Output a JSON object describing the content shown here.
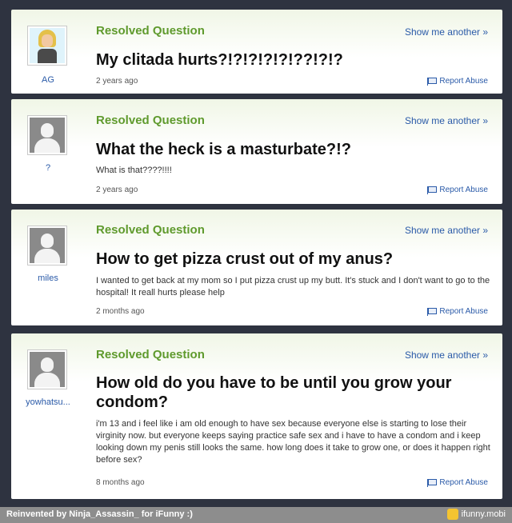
{
  "cards": [
    {
      "username": "AG",
      "resolved_label": "Resolved Question",
      "show_another": "Show me another »",
      "title": "My clitada hurts?!?!?!?!?!??!?!?",
      "body": "",
      "age": "2 years ago",
      "report": "Report Abuse"
    },
    {
      "username": "?",
      "resolved_label": "Resolved Question",
      "show_another": "Show me another »",
      "title": "What the heck is a masturbate?!?",
      "body": "What is that????!!!!",
      "age": "2 years ago",
      "report": "Report Abuse"
    },
    {
      "username": "miles",
      "resolved_label": "Resolved Question",
      "show_another": "Show me another »",
      "title": "How to get pizza crust out of my anus?",
      "body": "I wanted to get back at my mom so I put pizza crust up my butt. It's stuck and I don't want to go to the hospital! It reall hurts please help",
      "age": "2 months ago",
      "report": "Report Abuse"
    },
    {
      "username": "yowhatsu...",
      "resolved_label": "Resolved Question",
      "show_another": "Show me another »",
      "title": "How old do you have to be until you grow your condom?",
      "body": "i'm 13 and i feel like i am old enough to have sex because everyone else is starting to lose their virginity now. but everyone keeps saying practice safe sex and i have to have a condom and i keep looking down my penis still looks the same. how long does it take to grow one, or does it happen right before sex?",
      "age": "8 months ago",
      "report": "Report Abuse"
    }
  ],
  "footer": {
    "left": "Reinvented by Ninja_Assassin_ for iFunny :)",
    "right": "ifunny.mobi"
  },
  "colors": {
    "resolved": "#5f9a2d",
    "link": "#2a5aa8",
    "background": "#2e3340"
  }
}
